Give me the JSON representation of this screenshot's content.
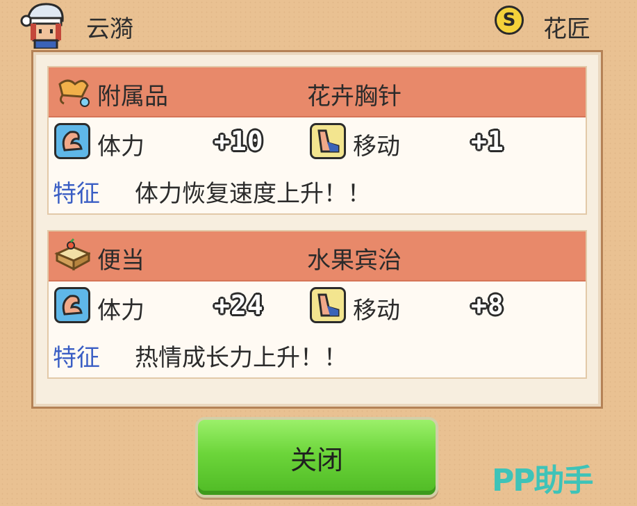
{
  "header": {
    "character_name": "云漪",
    "rank_badge": "S",
    "job": "花匠"
  },
  "items": [
    {
      "category": "附属品",
      "category_icon": "brooch-icon",
      "name": "花卉胸针",
      "stats": [
        {
          "label": "体力",
          "value": "+10",
          "icon": "arm-muscle-icon"
        },
        {
          "label": "移动",
          "value": "+1",
          "icon": "boot-icon"
        }
      ],
      "trait_label": "特征",
      "trait_text": "体力恢复速度上升！！"
    },
    {
      "category": "便当",
      "category_icon": "bento-icon",
      "name": "水果宾治",
      "stats": [
        {
          "label": "体力",
          "value": "+24",
          "icon": "arm-muscle-icon"
        },
        {
          "label": "移动",
          "value": "+8",
          "icon": "boot-icon"
        }
      ],
      "trait_label": "特征",
      "trait_text": "热情成长力上升！！"
    }
  ],
  "close_button": "关闭",
  "watermark": "PP助手",
  "colors": {
    "header_bar": "#e8896a",
    "trait_label": "#3a5ec4",
    "button": "#6cd53a"
  }
}
